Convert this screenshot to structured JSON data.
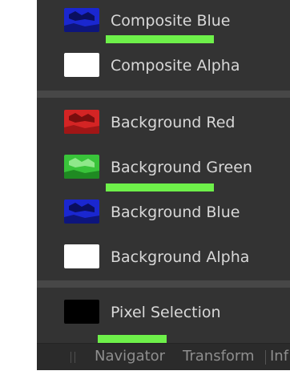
{
  "channels": {
    "composite_blue": {
      "label": "Composite Blue",
      "color": "#1a27d0"
    },
    "composite_alpha": {
      "label": "Composite Alpha",
      "color": "#ffffff"
    },
    "background_red": {
      "label": "Background Red",
      "color": "#d42424"
    },
    "background_green": {
      "label": "Background Green",
      "color": "#39c43a"
    },
    "background_blue": {
      "label": "Background Blue",
      "color": "#1a27d0"
    },
    "background_alpha": {
      "label": "Background Alpha",
      "color": "#ffffff"
    },
    "pixel_selection": {
      "label": "Pixel Selection",
      "color": "#000000"
    }
  },
  "tabs": {
    "navigator": "Navigator",
    "transform": "Transform",
    "info": "Inf"
  },
  "highlight_color": "#6ef04a",
  "panel_color": "#333333"
}
